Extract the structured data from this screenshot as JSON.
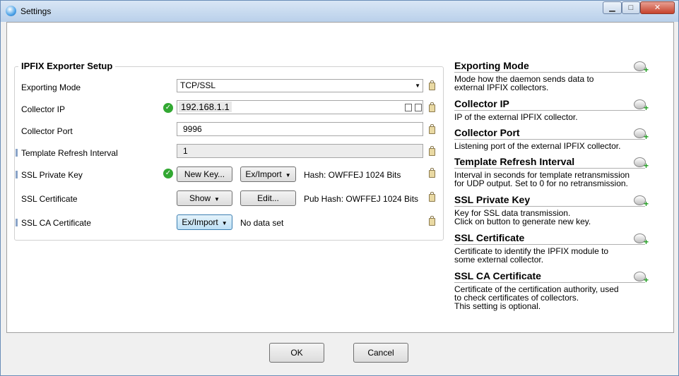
{
  "window": {
    "title": "Settings",
    "controls": {
      "minimize": "▁",
      "maximize": "□",
      "close": "✕"
    }
  },
  "group": {
    "title": "IPFIX Exporter Setup"
  },
  "form": {
    "exporting_mode": {
      "label": "Exporting Mode",
      "value": "TCP/SSL"
    },
    "collector_ip": {
      "label": "Collector IP",
      "value": "192.168.1.1"
    },
    "collector_port": {
      "label": "Collector Port",
      "value": "9996"
    },
    "template_refresh": {
      "label": "Template Refresh Interval",
      "value": "1"
    },
    "ssl_private_key": {
      "label": "SSL Private Key",
      "button1": "New Key...",
      "button2": "Ex/Import",
      "info": "Hash: OWFFEJ 1024 Bits"
    },
    "ssl_certificate": {
      "label": "SSL Certificate",
      "button1": "Show",
      "button2": "Edit...",
      "info": "Pub Hash: OWFFEJ 1024 Bits"
    },
    "ssl_ca_certificate": {
      "label": "SSL CA Certificate",
      "button1": "Ex/Import",
      "info": "No data set"
    }
  },
  "help": [
    {
      "heading": "Exporting Mode",
      "desc": "Mode how the daemon sends data to\nexternal IPFIX collectors."
    },
    {
      "heading": "Collector IP",
      "desc": "IP of the external IPFIX collector."
    },
    {
      "heading": "Collector Port",
      "desc": "Listening port of the external IPFIX collector."
    },
    {
      "heading": "Template Refresh Interval",
      "desc": "Interval in seconds for template retransmission\nfor UDP output. Set to 0 for no retransmission."
    },
    {
      "heading": "SSL Private Key",
      "desc": "Key for SSL data transmission.\nClick on button to generate new key."
    },
    {
      "heading": "SSL Certificate",
      "desc": "Certificate to identify the IPFIX module to\nsome external collector."
    },
    {
      "heading": "SSL CA Certificate",
      "desc": "Certificate of the certification authority, used\nto check certificates of collectors.\nThis setting is optional."
    }
  ],
  "footer": {
    "ok": "OK",
    "cancel": "Cancel"
  },
  "icons": {
    "check": "✓",
    "dropdown": "▼"
  },
  "colors": {
    "check_green": "#32a832",
    "title_bar": "#c8daef",
    "focus_blue": "#3c7fb1"
  }
}
